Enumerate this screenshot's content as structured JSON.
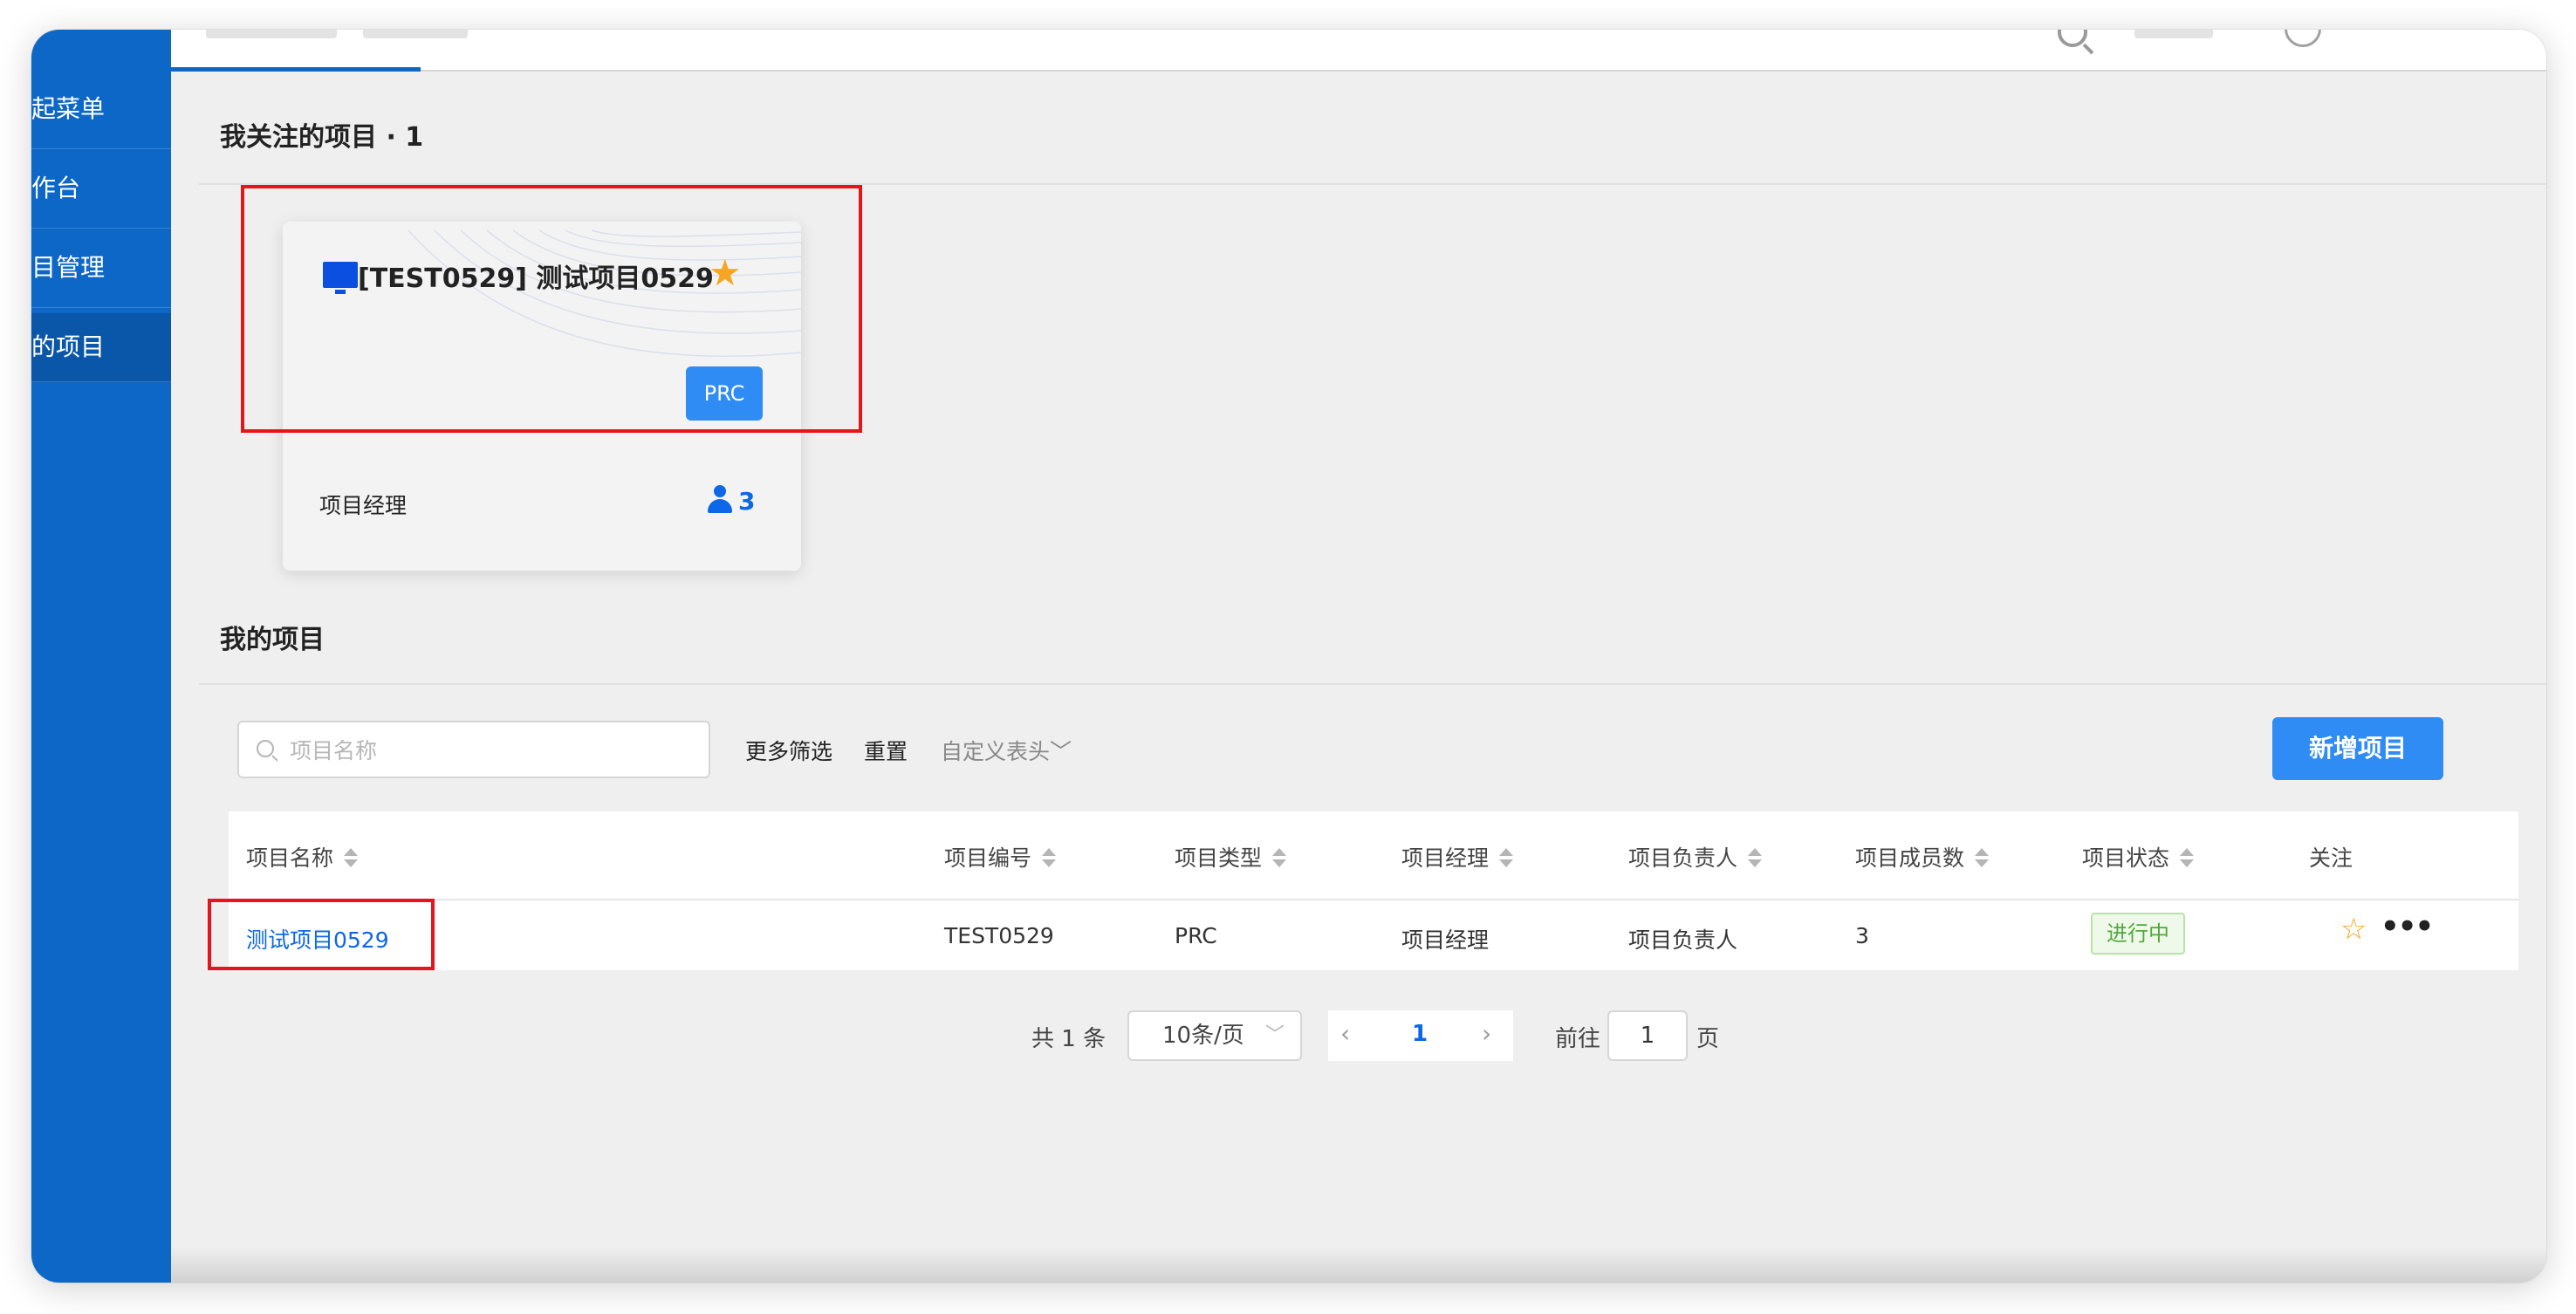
{
  "sidebar": {
    "items": [
      {
        "label": "起菜单"
      },
      {
        "label": "作台"
      },
      {
        "label": "目管理"
      },
      {
        "label": "的项目",
        "active": true
      }
    ]
  },
  "followed": {
    "title": "我关注的项目 · 1",
    "card": {
      "title": "[TEST0529] 测试项目0529",
      "type": "PRC",
      "manager_label": "项目经理",
      "member_count": "3",
      "star_color": "#f5a623",
      "icon": "monitor-icon"
    }
  },
  "my_projects": {
    "title": "我的项目",
    "search": {
      "placeholder": "项目名称",
      "value": ""
    },
    "toolbar": {
      "more_filters": "更多筛选",
      "reset": "重置",
      "custom_header": "自定义表头",
      "add_project": "新增项目"
    },
    "table": {
      "columns": [
        "项目名称",
        "项目编号",
        "项目类型",
        "项目经理",
        "项目负责人",
        "项目成员数",
        "项目状态",
        "关注"
      ],
      "rows": [
        {
          "name": "测试项目0529",
          "code": "TEST0529",
          "type": "PRC",
          "manager": "项目经理",
          "owner": "项目负责人",
          "members": "3",
          "status": "进行中"
        }
      ]
    },
    "pagination": {
      "total": "共 1 条",
      "page_size": "10条/页",
      "current_page": "1",
      "goto_label": "前往",
      "goto_value": "1",
      "unit": "页"
    }
  },
  "colors": {
    "sidebar": "#0d67c6",
    "primary": "#2f8cf5",
    "highlight": "#e8141b",
    "status_green": "#52a83a"
  }
}
